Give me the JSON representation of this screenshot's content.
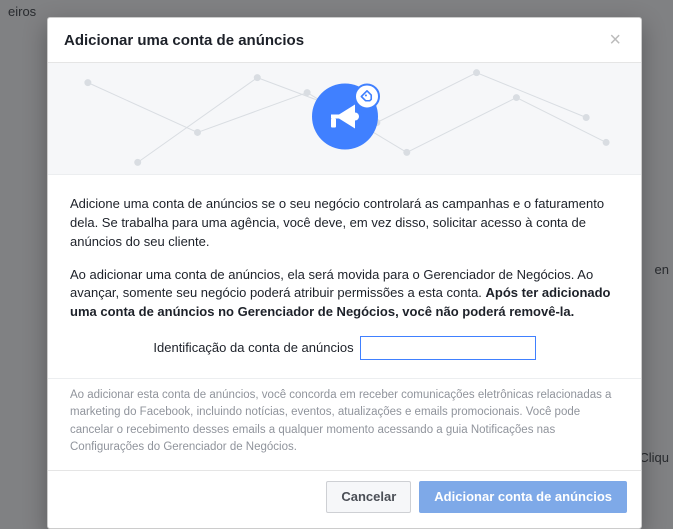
{
  "background": {
    "nav_item": "eiros",
    "side_word_1": "en",
    "side_word_2": "Cliqu"
  },
  "modal": {
    "title": "Adicionar uma conta de anúncios",
    "paragraph1": "Adicione uma conta de anúncios se o seu negócio controlará as campanhas e o faturamento dela. Se trabalha para uma agência, você deve, em vez disso, solicitar acesso à conta de anúncios do seu cliente.",
    "paragraph2_prefix": "Ao adicionar uma conta de anúncios, ela será movida para o Gerenciador de Negócios. Ao avançar, somente seu negócio poderá atribuir permissões a esta conta. ",
    "paragraph2_bold": "Após ter adicionado uma conta de anúncios no Gerenciador de Negócios, você não poderá removê-la.",
    "field_label": "Identificação da conta de anúncios",
    "field_value": "",
    "disclaimer": "Ao adicionar esta conta de anúncios, você concorda em receber comunicações eletrônicas relacionadas a marketing do Facebook, incluindo notícias, eventos, atualizações e emails promocionais. Você pode cancelar o recebimento desses emails a qualquer momento acessando a guia Notificações nas Configurações do Gerenciador de Negócios.",
    "buttons": {
      "cancel": "Cancelar",
      "submit": "Adicionar conta de anúncios"
    }
  },
  "icons": {
    "hero": "megaphone-icon",
    "hero_badge": "tag-icon",
    "close": "close-icon"
  },
  "colors": {
    "primary": "#4080ff",
    "primary_disabled": "#7ea9e8",
    "text_muted": "#90949c"
  }
}
